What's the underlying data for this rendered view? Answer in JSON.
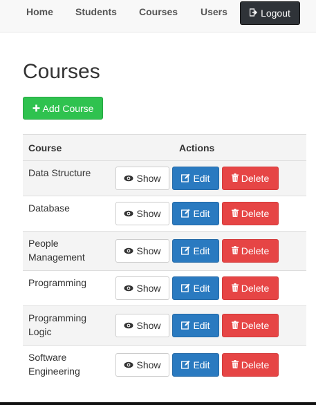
{
  "nav": {
    "items": [
      {
        "label": "Home"
      },
      {
        "label": "Students"
      },
      {
        "label": "Courses"
      },
      {
        "label": "Users"
      }
    ],
    "logout_label": "Logout"
  },
  "page": {
    "title": "Courses",
    "add_label": "Add Course"
  },
  "table": {
    "headers": {
      "course": "Course",
      "actions": "Actions"
    },
    "rows": [
      {
        "name": "Data Structure",
        "show": "Show",
        "edit": "Edit",
        "delete": "Delete"
      },
      {
        "name": "Database",
        "show": "Show",
        "edit": "Edit",
        "delete": "Delete"
      },
      {
        "name": "People Management",
        "show": "Show",
        "edit": "Edit",
        "delete": "Delete"
      },
      {
        "name": "Programming",
        "show": "Show",
        "edit": "Edit",
        "delete": "Delete"
      },
      {
        "name": "Programming Logic",
        "show": "Show",
        "edit": "Edit",
        "delete": "Delete"
      },
      {
        "name": "Software Engineering",
        "show": "Show",
        "edit": "Edit",
        "delete": "Delete"
      }
    ]
  },
  "icons": {
    "logout": "sign-out-icon",
    "add": "plus-icon",
    "show": "eye-icon",
    "edit": "edit-icon",
    "delete": "trash-icon"
  },
  "colors": {
    "add": "#2fc24f",
    "edit": "#2a7ac0",
    "delete": "#e64545",
    "logout": "#2f3338"
  }
}
